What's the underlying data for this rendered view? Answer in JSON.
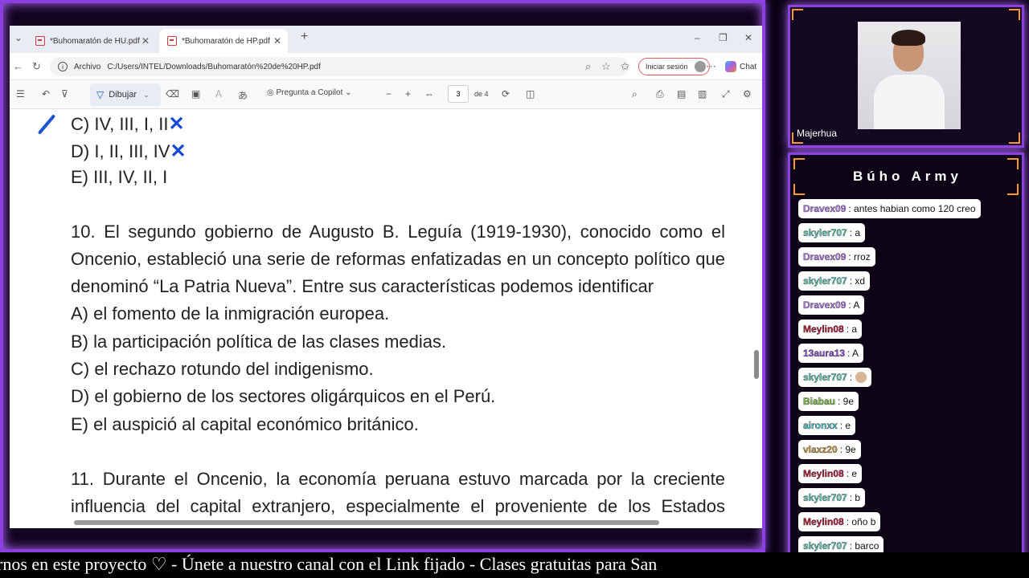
{
  "browser": {
    "tabs": [
      {
        "label": "*Buhomaratón de HU.pdf"
      },
      {
        "label": "*Buhomaratón de HP.pdf"
      }
    ],
    "address": {
      "scheme": "Archivo",
      "url": "C:/Users/INTEL/Downloads/Buhomaratón%20de%20HP.pdf"
    },
    "signin_label": "Iniciar sesión",
    "chat_label": "Chat"
  },
  "pdf_toolbar": {
    "draw_label": "Dibujar",
    "copilot_label": "Pregunta a Copilot",
    "page_current": "3",
    "page_total": "de 4"
  },
  "document": {
    "prev_options": [
      "C) IV, III, I, II",
      "D) I, II, III, IV",
      "E) III, IV, II, I"
    ],
    "q10_lines": [
      "10. El segundo gobierno de Augusto B. Leguía (1919-1930), conocido como el",
      "Oncenio, estableció una serie de reformas enfatizadas en un concepto político que",
      "denominó “La Patria Nueva”. Entre sus características podemos identificar"
    ],
    "q10_options": [
      "A) el fomento de la inmigración europea.",
      "B) la participación política de las clases medias.",
      "C) el rechazo rotundo del indigenismo.",
      "D) el gobierno de los sectores oligárquicos en el Perú.",
      "E) el auspició al capital económico británico."
    ],
    "q11_lines": [
      "11. Durante el Oncenio, la economía peruana estuvo marcada por la creciente",
      "influencia del capital extranjero, especialmente el proveniente de los Estados"
    ]
  },
  "webcam": {
    "name": "Majerhua"
  },
  "chat": {
    "title": "Búho Army",
    "messages": [
      {
        "user": "Dravex09",
        "text": ": antes habian como 120 creo",
        "color": "#b07be0"
      },
      {
        "user": "skyler707",
        "text": ": a",
        "color": "#5fc7b0"
      },
      {
        "user": "Dravex09",
        "text": ": rroz",
        "color": "#b07be0"
      },
      {
        "user": "skyler707",
        "text": ": xd",
        "color": "#5fc7b0"
      },
      {
        "user": "Dravex09",
        "text": ": A",
        "color": "#b07be0"
      },
      {
        "user": "Meylin08",
        "text": ": a",
        "color": "#b0203a"
      },
      {
        "user": "13aura13",
        "text": ": A",
        "color": "#8a4fd0"
      },
      {
        "user": "skyler707",
        "text": ":",
        "color": "#5fc7b0",
        "emote": true
      },
      {
        "user": "Biabau",
        "text": ": 9e",
        "color": "#7fbf4a"
      },
      {
        "user": "aironxx",
        "text": ": e",
        "color": "#4fc0c8"
      },
      {
        "user": "vlaxz20",
        "text": ": 9e",
        "color": "#c79a4a"
      },
      {
        "user": "Meylin08",
        "text": ": e",
        "color": "#b0203a"
      },
      {
        "user": "skyler707",
        "text": ": b",
        "color": "#5fc7b0"
      },
      {
        "user": "Meylin08",
        "text": ": oño b",
        "color": "#b0203a"
      },
      {
        "user": "skyler707",
        "text": ": barco",
        "color": "#5fc7b0"
      }
    ]
  },
  "ticker": {
    "text": "rnos en este proyecto ♡  -  Únete a nuestro canal con el Link fijado  -  Clases gratuitas para San"
  }
}
